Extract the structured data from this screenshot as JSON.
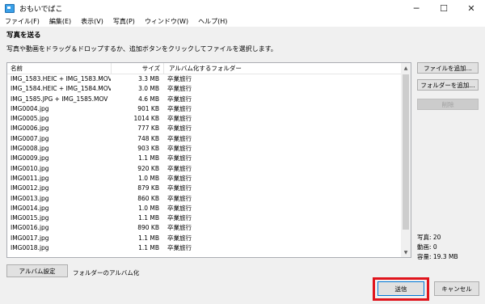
{
  "window": {
    "title": "おもいでばこ",
    "controls": {
      "minimize": "─",
      "maximize": "☐",
      "close": "✕"
    }
  },
  "menu": [
    "ファイル(F)",
    "編集(E)",
    "表示(V)",
    "写真(P)",
    "ウィンドウ(W)",
    "ヘルプ(H)"
  ],
  "section_title": "写真を送る",
  "instruction": "写真や動画をドラッグ＆ドロップするか、追加ボタンをクリックしてファイルを選択します。",
  "table": {
    "headers": {
      "name": "名前",
      "size": "サイズ",
      "album": "アルバム化するフォルダー"
    },
    "rows": [
      {
        "name": "IMG_1583.HEIC + IMG_1583.MOV",
        "size": "3.3 MB",
        "album": "卒業旅行"
      },
      {
        "name": "IMG_1584.HEIC + IMG_1584.MOV",
        "size": "3.0 MB",
        "album": "卒業旅行"
      },
      {
        "name": "IMG_1585.JPG + IMG_1585.MOV",
        "size": "4.6 MB",
        "album": "卒業旅行"
      },
      {
        "name": "IMG0004.jpg",
        "size": "901 KB",
        "album": "卒業旅行"
      },
      {
        "name": "IMG0005.jpg",
        "size": "1014 KB",
        "album": "卒業旅行"
      },
      {
        "name": "IMG0006.jpg",
        "size": "777 KB",
        "album": "卒業旅行"
      },
      {
        "name": "IMG0007.jpg",
        "size": "748 KB",
        "album": "卒業旅行"
      },
      {
        "name": "IMG0008.jpg",
        "size": "903 KB",
        "album": "卒業旅行"
      },
      {
        "name": "IMG0009.jpg",
        "size": "1.1 MB",
        "album": "卒業旅行"
      },
      {
        "name": "IMG0010.jpg",
        "size": "920 KB",
        "album": "卒業旅行"
      },
      {
        "name": "IMG0011.jpg",
        "size": "1.0 MB",
        "album": "卒業旅行"
      },
      {
        "name": "IMG0012.jpg",
        "size": "879 KB",
        "album": "卒業旅行"
      },
      {
        "name": "IMG0013.jpg",
        "size": "860 KB",
        "album": "卒業旅行"
      },
      {
        "name": "IMG0014.jpg",
        "size": "1.0 MB",
        "album": "卒業旅行"
      },
      {
        "name": "IMG0015.jpg",
        "size": "1.1 MB",
        "album": "卒業旅行"
      },
      {
        "name": "IMG0016.jpg",
        "size": "890 KB",
        "album": "卒業旅行"
      },
      {
        "name": "IMG0017.jpg",
        "size": "1.1 MB",
        "album": "卒業旅行"
      },
      {
        "name": "IMG0018.jpg",
        "size": "1.1 MB",
        "album": "卒業旅行"
      }
    ]
  },
  "side_buttons": {
    "add_file": "ファイルを追加...",
    "add_folder": "フォルダーを追加...",
    "delete": "削除"
  },
  "stats": {
    "photos": "写真: 20",
    "videos": "動画: 0",
    "capacity": "容量: 19.3 MB"
  },
  "bottom": {
    "album_settings": "アルバム設定",
    "album_label": "フォルダーのアルバム化",
    "send": "送信",
    "cancel": "キャンセル"
  },
  "colors": {
    "highlight": "#e0141c",
    "accent": "#0078d7"
  }
}
